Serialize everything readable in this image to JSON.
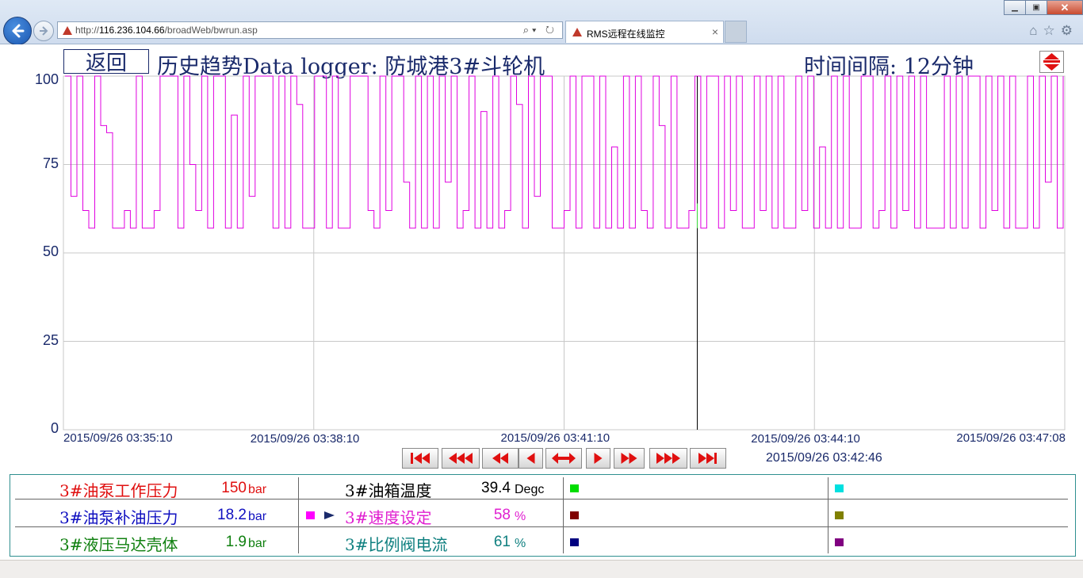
{
  "browser": {
    "url_prefix": "http://",
    "url_host": "116.236.104.66",
    "url_path": "/broadWeb/bwrun.asp",
    "tab_title": "RMS远程在线监控",
    "tab_close": "×",
    "addr_tools": "⌕▾ ↻",
    "toolbar_icons": "⌂☆⚙",
    "win_min": "▁",
    "win_max": "▣",
    "win_close": "✕"
  },
  "header": {
    "return_label": "返回",
    "title": "历史趋势Data logger: 防城港3#斗轮机",
    "interval_label": "时间间隔: 12分钟"
  },
  "chart_data": {
    "type": "line",
    "ylim": [
      0,
      100
    ],
    "yticks": [
      "100",
      "75",
      "50",
      "25",
      "0"
    ],
    "xticks": [
      "2015/09/26 03:35:10",
      "2015/09/26 03:38:10",
      "2015/09/26 03:41:10",
      "2015/09/26 03:44:10",
      "2015/09/26 03:47:08"
    ],
    "cursor_time": "2015/09/26 03:42:46",
    "cursor_fraction": 0.633,
    "grid": true,
    "series": [
      {
        "color": "#e000e0",
        "values": [
          100,
          66,
          100,
          62,
          57,
          100,
          86,
          84,
          57,
          57,
          62,
          57,
          100,
          57,
          57,
          62,
          100,
          100,
          100,
          57,
          100,
          75,
          62,
          100,
          57,
          100,
          100,
          57,
          89,
          57,
          100,
          66,
          100,
          100,
          100,
          57,
          100,
          57,
          100,
          92,
          57,
          57,
          100,
          100,
          57,
          100,
          57,
          57,
          100,
          100,
          100,
          62,
          57,
          100,
          62,
          100,
          100,
          70,
          57,
          100,
          57,
          100,
          57,
          100,
          70,
          100,
          57,
          62,
          100,
          57,
          90,
          57,
          100,
          57,
          62,
          100,
          92,
          57,
          100,
          66,
          100,
          100,
          57,
          57,
          62,
          100,
          57,
          100,
          100,
          57,
          100,
          57,
          80,
          57,
          100,
          57,
          100,
          62,
          57,
          100,
          86,
          57,
          100,
          57,
          57,
          62,
          100,
          57,
          100,
          100,
          57,
          100,
          62,
          100,
          57,
          57,
          100,
          62,
          100,
          57,
          100,
          57,
          57,
          100,
          62,
          100,
          57,
          80,
          57,
          100,
          57,
          100,
          57,
          57,
          100,
          100,
          57,
          62,
          100,
          57,
          100,
          62,
          100,
          57,
          100,
          57,
          57,
          57,
          100,
          57,
          100,
          57,
          100,
          100,
          57,
          100,
          62,
          100,
          57,
          100,
          57,
          57,
          100,
          57,
          100,
          70,
          100,
          57,
          100
        ]
      }
    ]
  },
  "playback": {
    "buttons": [
      "first",
      "rewind-fast",
      "rewind",
      "step-back",
      "fit",
      "step-forward",
      "forward",
      "forward-fast",
      "last"
    ]
  },
  "legend": {
    "rows": [
      [
        {
          "name": "3#油泵工作压力",
          "value": "150",
          "unit": "bar",
          "color": "#e01010"
        },
        {
          "name": "3#油箱温度",
          "value": "39.4",
          "unit": "Degc",
          "color": "#000000"
        },
        {
          "swatch": "#00dd00"
        },
        {
          "swatch": "#00e0e0"
        }
      ],
      [
        {
          "name": "3#油泵补油压力",
          "value": "18.2",
          "unit": "bar",
          "color": "#1010c0"
        },
        {
          "name": "3#速度设定",
          "value": "58",
          "unit": "%",
          "color": "#e020d0",
          "swatch": "#ff00ff",
          "selected": true
        },
        {
          "swatch": "#800000"
        },
        {
          "swatch": "#808000"
        }
      ],
      [
        {
          "name": "3#液压马达壳体",
          "value": "1.9",
          "unit": "bar",
          "color": "#108010"
        },
        {
          "name": "3#比例阀电流",
          "value": "61",
          "unit": "%",
          "color": "#108080"
        },
        {
          "swatch": "#000080"
        },
        {
          "swatch": "#800080"
        }
      ]
    ]
  }
}
